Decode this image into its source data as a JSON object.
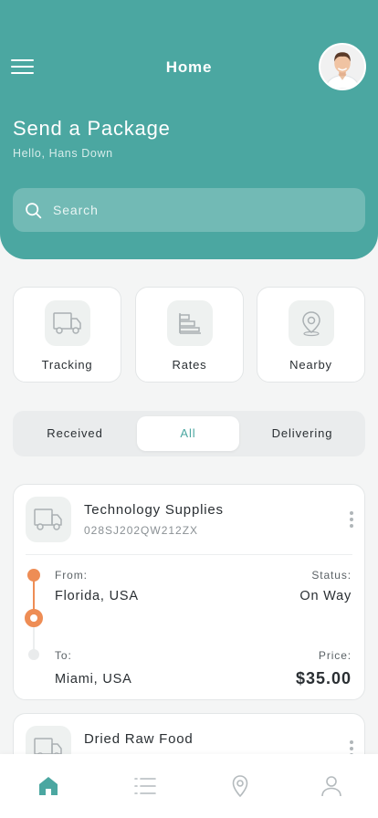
{
  "header": {
    "title": "Home",
    "page_title": "Send a Package",
    "greeting": "Hello, Hans Down"
  },
  "search": {
    "placeholder": "Search"
  },
  "quick_actions": [
    {
      "label": "Tracking",
      "icon": "truck-icon"
    },
    {
      "label": "Rates",
      "icon": "rates-chart-icon"
    },
    {
      "label": "Nearby",
      "icon": "location-pin-icon"
    }
  ],
  "tabs": [
    {
      "label": "Received",
      "active": false
    },
    {
      "label": "All",
      "active": true
    },
    {
      "label": "Delivering",
      "active": false
    }
  ],
  "shipments": [
    {
      "title": "Technology Supplies",
      "tracking_id": "028SJ202QW212ZX",
      "from_label": "From:",
      "from_value": "Florida, USA",
      "status_label": "Status:",
      "status_value": "On Way",
      "to_label": "To:",
      "to_value": "Miami, USA",
      "price_label": "Price:",
      "price_value": "$35.00"
    },
    {
      "title": "Dried Raw Food"
    }
  ],
  "bottom_nav": [
    {
      "name": "home",
      "icon": "home-icon",
      "active": true
    },
    {
      "name": "list",
      "icon": "list-icon",
      "active": false
    },
    {
      "name": "location",
      "icon": "location-icon",
      "active": false
    },
    {
      "name": "profile",
      "icon": "profile-icon",
      "active": false
    }
  ],
  "colors": {
    "primary": "#4ba7a1",
    "accent_orange": "#ee8d55",
    "background": "#f4f5f5",
    "card": "#ffffff",
    "inactive_icon": "#b4babd"
  }
}
